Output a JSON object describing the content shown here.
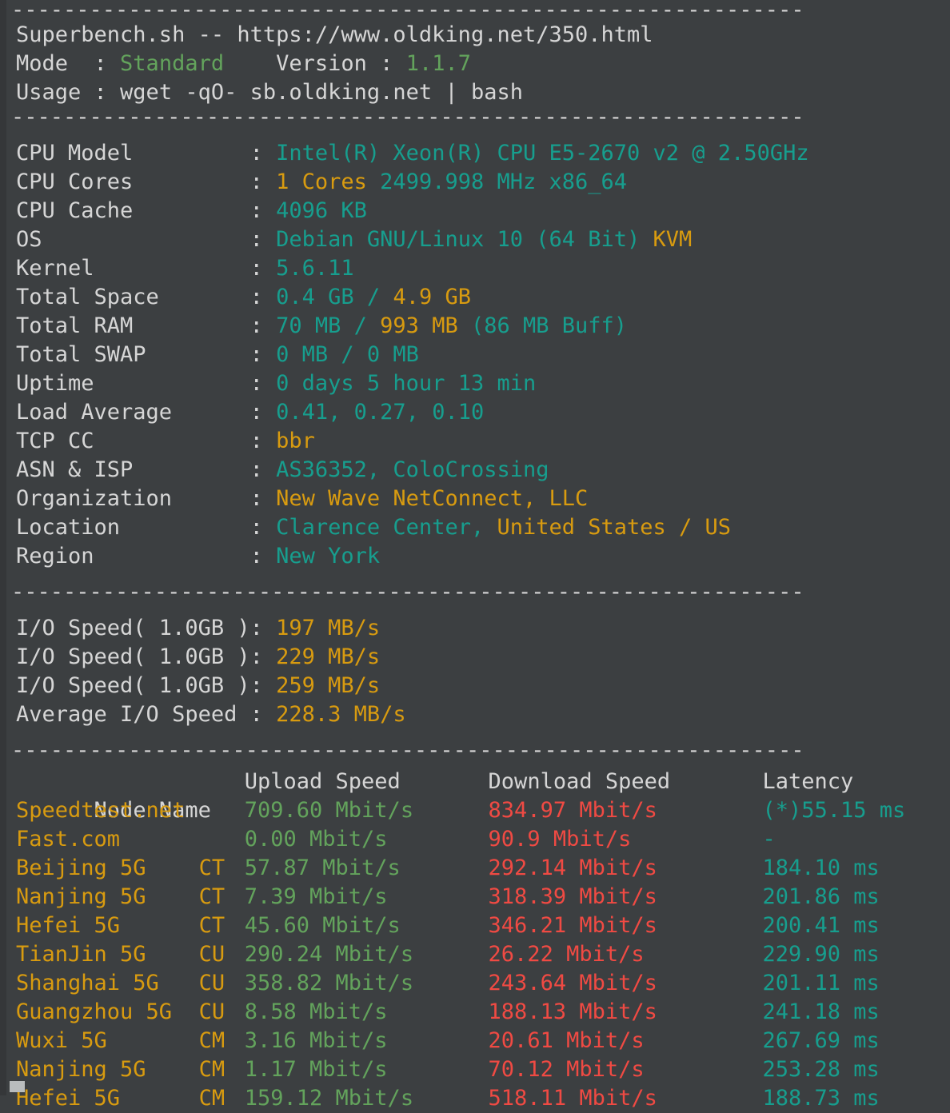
{
  "terminal": {
    "background_color": "#3c3f41",
    "default_text_color": "#d6d6d6",
    "colors": {
      "teal": "#179e8e",
      "orange": "#d89b10",
      "green": "#63a35c",
      "red": "#f04a43",
      "white": "#d6d6d6"
    },
    "separator": "-------------------------------------------------------------"
  },
  "header": {
    "title": "Superbench.sh -- https://www.oldking.net/350.html",
    "mode_label": "Mode  : ",
    "mode_value": "Standard",
    "version_label": "Version : ",
    "version_value": "1.1.7",
    "usage_label": "Usage : ",
    "usage_value": "wget -qO- sb.oldking.net | bash"
  },
  "sysinfo": {
    "rows": [
      {
        "label": "CPU Model",
        "sep": ":",
        "parts": [
          {
            "text": "Intel(R) Xeon(R) CPU E5-2670 v2 @ 2.50GHz",
            "color": "teal"
          }
        ]
      },
      {
        "label": "CPU Cores",
        "sep": ":",
        "parts": [
          {
            "text": "1 Cores",
            "color": "orange"
          },
          {
            "text": " 2499.998 MHz x86_64",
            "color": "teal"
          }
        ]
      },
      {
        "label": "CPU Cache",
        "sep": ":",
        "parts": [
          {
            "text": "4096 KB",
            "color": "teal"
          }
        ]
      },
      {
        "label": "OS",
        "sep": ":",
        "parts": [
          {
            "text": "Debian GNU/Linux 10 (64 Bit) ",
            "color": "teal"
          },
          {
            "text": "KVM",
            "color": "orange"
          }
        ]
      },
      {
        "label": "Kernel",
        "sep": ":",
        "parts": [
          {
            "text": "5.6.11",
            "color": "teal"
          }
        ]
      },
      {
        "label": "Total Space",
        "sep": ":",
        "parts": [
          {
            "text": "0.4 GB / ",
            "color": "teal"
          },
          {
            "text": "4.9 GB",
            "color": "orange"
          }
        ]
      },
      {
        "label": "Total RAM",
        "sep": ":",
        "parts": [
          {
            "text": "70 MB / ",
            "color": "teal"
          },
          {
            "text": "993 MB",
            "color": "orange"
          },
          {
            "text": " (86 MB Buff)",
            "color": "teal"
          }
        ]
      },
      {
        "label": "Total SWAP",
        "sep": ":",
        "parts": [
          {
            "text": "0 MB / 0 MB",
            "color": "teal"
          }
        ]
      },
      {
        "label": "Uptime",
        "sep": ":",
        "parts": [
          {
            "text": "0 days 5 hour 13 min",
            "color": "teal"
          }
        ]
      },
      {
        "label": "Load Average",
        "sep": ":",
        "parts": [
          {
            "text": "0.41, 0.27, 0.10",
            "color": "teal"
          }
        ]
      },
      {
        "label": "TCP CC",
        "sep": ":",
        "parts": [
          {
            "text": "bbr",
            "color": "orange"
          }
        ]
      },
      {
        "label": "ASN & ISP",
        "sep": ":",
        "parts": [
          {
            "text": "AS36352, ColoCrossing",
            "color": "teal"
          }
        ]
      },
      {
        "label": "Organization",
        "sep": ":",
        "parts": [
          {
            "text": "New Wave NetConnect, LLC",
            "color": "orange"
          }
        ]
      },
      {
        "label": "Location",
        "sep": ":",
        "parts": [
          {
            "text": "Clarence Center, ",
            "color": "teal"
          },
          {
            "text": "United States / US",
            "color": "orange"
          }
        ]
      },
      {
        "label": "Region",
        "sep": ":",
        "parts": [
          {
            "text": "New York",
            "color": "teal"
          }
        ]
      }
    ]
  },
  "io": {
    "rows": [
      {
        "label": "I/O Speed( 1.0GB )",
        "sep": ":",
        "value": "197 MB/s",
        "color": "orange"
      },
      {
        "label": "I/O Speed( 1.0GB )",
        "sep": ":",
        "value": "229 MB/s",
        "color": "orange"
      },
      {
        "label": "I/O Speed( 1.0GB )",
        "sep": ":",
        "value": "259 MB/s",
        "color": "orange"
      },
      {
        "label": "Average I/O Speed",
        "sep": ":",
        "value": "228.3 MB/s",
        "color": "orange"
      }
    ]
  },
  "speedtest": {
    "headers": {
      "node": "Node Name",
      "upload": "Upload Speed",
      "download": "Download Speed",
      "latency": "Latency"
    },
    "rows": [
      {
        "node": "Speedtest.net",
        "isp": "",
        "upload": "709.60 Mbit/s",
        "download": "834.97 Mbit/s",
        "latency": "(*)55.15 ms"
      },
      {
        "node": "Fast.com",
        "isp": "",
        "upload": "0.00 Mbit/s",
        "download": "90.9 Mbit/s",
        "latency": "-"
      },
      {
        "node": "Beijing 5G",
        "isp": "CT",
        "upload": "57.87 Mbit/s",
        "download": "292.14 Mbit/s",
        "latency": "184.10 ms"
      },
      {
        "node": "Nanjing 5G",
        "isp": "CT",
        "upload": "7.39 Mbit/s",
        "download": "318.39 Mbit/s",
        "latency": "201.86 ms"
      },
      {
        "node": "Hefei 5G",
        "isp": "CT",
        "upload": "45.60 Mbit/s",
        "download": "346.21 Mbit/s",
        "latency": "200.41 ms"
      },
      {
        "node": "TianJin 5G",
        "isp": "CU",
        "upload": "290.24 Mbit/s",
        "download": "26.22 Mbit/s",
        "latency": "229.90 ms"
      },
      {
        "node": "Shanghai 5G",
        "isp": "CU",
        "upload": "358.82 Mbit/s",
        "download": "243.64 Mbit/s",
        "latency": "201.11 ms"
      },
      {
        "node": "Guangzhou 5G",
        "isp": "CU",
        "upload": "8.58 Mbit/s",
        "download": "188.13 Mbit/s",
        "latency": "241.18 ms"
      },
      {
        "node": "Wuxi 5G",
        "isp": "CM",
        "upload": "3.16 Mbit/s",
        "download": "20.61 Mbit/s",
        "latency": "267.69 ms"
      },
      {
        "node": "Nanjing 5G",
        "isp": "CM",
        "upload": "1.17 Mbit/s",
        "download": "70.12 Mbit/s",
        "latency": "253.28 ms"
      },
      {
        "node": "Hefei 5G",
        "isp": "CM",
        "upload": "159.12 Mbit/s",
        "download": "518.11 Mbit/s",
        "latency": "188.73 ms"
      }
    ]
  }
}
